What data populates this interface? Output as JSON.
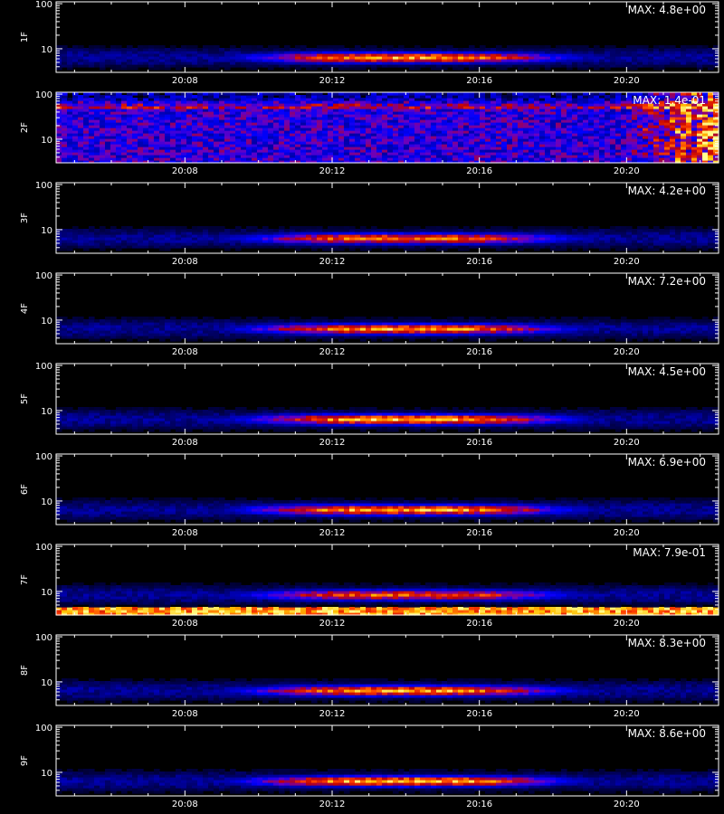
{
  "chart_data": {
    "type": "heatmap",
    "x_axis": {
      "type": "time",
      "range": [
        "20:04:30",
        "20:22:30"
      ],
      "ticks": [
        "20:08",
        "20:12",
        "20:16",
        "20:20"
      ]
    },
    "y_axis": {
      "scale": "log",
      "range": [
        3,
        110
      ],
      "ticks": [
        "10",
        "100"
      ]
    },
    "colormap": [
      "#000000",
      "#0000a0",
      "#0000ff",
      "#6a00c0",
      "#c00000",
      "#ff4000",
      "#ffc000",
      "#ffff90"
    ],
    "panels": [
      {
        "label": "1F",
        "max_text": "MAX: 4.8e+00",
        "pattern": "band",
        "band_center": 6.5,
        "peak": 0.85,
        "t_start": "20:10",
        "t_end": "20:18"
      },
      {
        "label": "2F",
        "max_text": "MAX: 1.4e-01",
        "pattern": "noise_high",
        "band_center": 50,
        "peak": 0.6
      },
      {
        "label": "3F",
        "max_text": "MAX: 4.2e+00",
        "pattern": "band",
        "band_center": 6.5,
        "peak": 0.8,
        "t_start": "20:10",
        "t_end": "20:18"
      },
      {
        "label": "4F",
        "max_text": "MAX: 7.2e+00",
        "pattern": "band",
        "band_center": 6.5,
        "peak": 0.85,
        "t_start": "20:10",
        "t_end": "20:18"
      },
      {
        "label": "5F",
        "max_text": "MAX: 4.5e+00",
        "pattern": "band",
        "band_center": 6.5,
        "peak": 0.9,
        "t_start": "20:10",
        "t_end": "20:18"
      },
      {
        "label": "6F",
        "max_text": "MAX: 6.9e+00",
        "pattern": "band",
        "band_center": 6.5,
        "peak": 0.88,
        "t_start": "20:10",
        "t_end": "20:18"
      },
      {
        "label": "7F",
        "max_text": "MAX: 7.9e-01",
        "pattern": "band_low_stripe",
        "band_center": 8.5,
        "peak": 0.75,
        "t_start": "20:10",
        "t_end": "20:18"
      },
      {
        "label": "8F",
        "max_text": "MAX: 8.3e+00",
        "pattern": "band",
        "band_center": 6.5,
        "peak": 0.85,
        "t_start": "20:10",
        "t_end": "20:18"
      },
      {
        "label": "9F",
        "max_text": "MAX: 8.6e+00",
        "pattern": "band",
        "band_center": 6.5,
        "peak": 0.9,
        "t_start": "20:10",
        "t_end": "20:18"
      }
    ]
  }
}
